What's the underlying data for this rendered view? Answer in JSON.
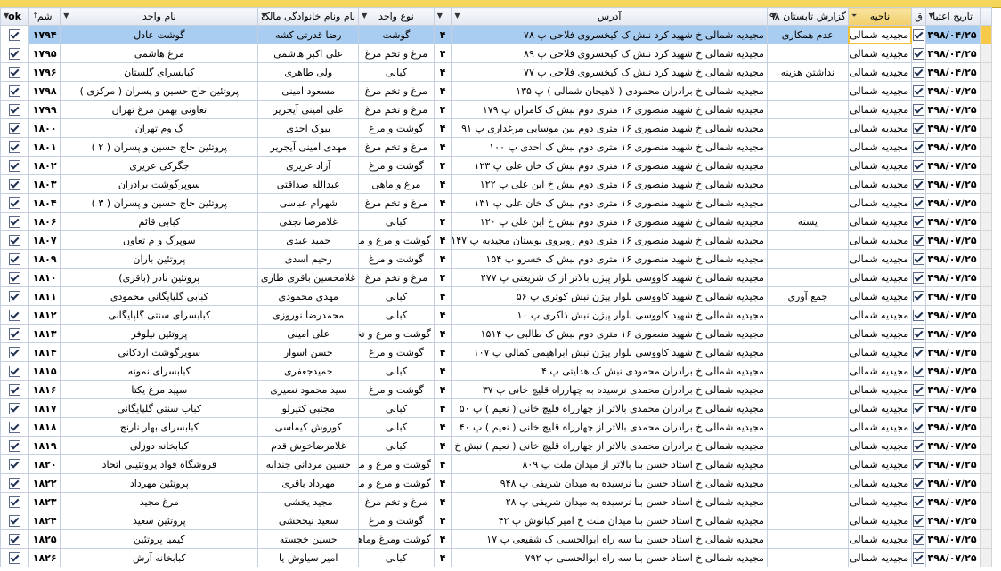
{
  "columns": [
    {
      "key": "validity_date",
      "label": "تاریخ اعتبا"
    },
    {
      "key": "qr",
      "label": "ق"
    },
    {
      "key": "region",
      "label": "ناحیه"
    },
    {
      "key": "report",
      "label": "گزارش تابستان ۹۸"
    },
    {
      "key": "address",
      "label": "آدرس"
    },
    {
      "key": "n4",
      "label": ""
    },
    {
      "key": "unit_type",
      "label": "نوع واحد"
    },
    {
      "key": "owner",
      "label": "نام ونام خانوادگی مالک"
    },
    {
      "key": "unit_name",
      "label": "نام واحد"
    },
    {
      "key": "number",
      "label": "شم"
    },
    {
      "key": "ok",
      "label": "ok"
    }
  ],
  "rows": [
    {
      "date": "۱۳۹۸/۰۴/۲۵",
      "region": "مجیدیه شمالی",
      "report": "عدم همکاری",
      "address": "مجیدیه شمالی خ شهید کرد نبش ک کیخسروی فلاحی پ ۷۸",
      "n4": "۴",
      "type": "گوشت",
      "owner": "رضا قدرتی کشه",
      "name": "گوشت عادل",
      "num": "۱۷۹۴",
      "selected": true
    },
    {
      "date": "۱۳۹۸/۰۴/۲۵",
      "region": "مجیدیه شمالی",
      "report": "",
      "address": "مجیدیه شمالی خ شهید کرد نبش ک کیخسروی فلاحی پ ۸۹",
      "n4": "۴",
      "type": "مرغ و تخم مرغ",
      "owner": "علی اکبر هاشمی",
      "name": "مرغ هاشمی",
      "num": "۱۷۹۵"
    },
    {
      "date": "۱۳۹۸/۰۴/۲۵",
      "region": "مجیدیه شمالی",
      "report": "نداشتن هزینه",
      "address": "مجیدیه شمالی خ شهید کرد نبش ک کیخسروی فلاحی پ ۷۷",
      "n4": "۴",
      "type": "کبابی",
      "owner": "ولی طاهری",
      "name": "کبابسرای گلستان",
      "num": "۱۷۹۶"
    },
    {
      "date": "۱۳۹۸/۰۷/۲۵",
      "region": "مجیدیه شمالی",
      "report": "",
      "address": "مجیدیه شمالی خ برادران محمودی ( لاهیجان شمالی ) پ ۱۳۵",
      "n4": "۴",
      "type": "مرغ و تخم مرغ",
      "owner": "مسعود امینی",
      "name": "پروتئین حاج حسین و پسران ( مرکزی )",
      "num": "۱۷۹۸"
    },
    {
      "date": "۱۳۹۸/۰۷/۲۵",
      "region": "مجیدیه شمالی",
      "report": "",
      "address": "مجیدیه شمالی خ شهید منصوری ۱۶ متری دوم نبش ک کامران پ ۱۷۹",
      "n4": "۴",
      "type": "مرغ و تخم مرغ",
      "owner": "علی امینی آیجریر",
      "name": "تعاونی بهمن مرغ تهران",
      "num": "۱۷۹۹"
    },
    {
      "date": "۱۳۹۸/۰۷/۲۵",
      "region": "مجیدیه شمالی",
      "report": "",
      "address": "مجیدیه شمالی خ شهید منصوری ۱۶ متری دوم بین موسایی مرغداری پ ۹۱",
      "n4": "۴",
      "type": "گوشت و مرغ",
      "owner": "بیوک احدی",
      "name": "گ وم تهران",
      "num": "۱۸۰۰"
    },
    {
      "date": "۱۳۹۸/۰۷/۲۵",
      "region": "مجیدیه شمالی",
      "report": "",
      "address": "مجیدیه شمالی خ شهید منصوری ۱۶ متری دوم نبش ک احدی پ ۱۰۰",
      "n4": "۴",
      "type": "مرغ و تخم مرغ",
      "owner": "مهدی امینی آیجریر",
      "name": "پروتئین حاج حسین و پسران ( ۲ )",
      "num": "۱۸۰۱"
    },
    {
      "date": "۱۳۹۸/۰۷/۲۵",
      "region": "مجیدیه شمالی",
      "report": "",
      "address": "مجیدیه شمالی خ شهید منصوری ۱۶ متری دوم نبش ک خان علی پ ۱۲۳",
      "n4": "۴",
      "type": "گوشت و مرغ",
      "owner": "آزاد عزیزی",
      "name": "جگرکی عزیزی",
      "num": "۱۸۰۲"
    },
    {
      "date": "۱۳۹۸/۰۷/۲۵",
      "region": "مجیدیه شمالی",
      "report": "",
      "address": "مجیدیه شمالی خ شهید منصوری ۱۶ متری دوم نبش خ ابن علی پ ۱۲۲",
      "n4": "۴",
      "type": "مرغ و ماهی",
      "owner": "عبدالله صداقتی",
      "name": "سوپرگوشت برادران",
      "num": "۱۸۰۳"
    },
    {
      "date": "۱۳۹۸/۰۷/۲۵",
      "region": "مجیدیه شمالی",
      "report": "",
      "address": "مجیدیه شمالی خ شهید منصوری ۱۶ متری دوم نبش ک خان علی پ ۱۳۱",
      "n4": "۴",
      "type": "مرغ و تخم مرغ",
      "owner": "شهرام عباسی",
      "name": "پروتئین حاج حسین و پسران ( ۳ )",
      "num": "۱۸۰۴"
    },
    {
      "date": "۱۳۹۸/۰۷/۲۵",
      "region": "مجیدیه شمالی",
      "report": "یسته",
      "address": "مجیدیه شمالی خ شهید منصوری ۱۶ متری دوم نبش خ ابن علی پ ۱۲۰",
      "n4": "۴",
      "type": "کبابی",
      "owner": "غلامرضا نجفی",
      "name": "کبابی قائم",
      "num": "۱۸۰۶"
    },
    {
      "date": "۱۳۹۸/۰۷/۲۵",
      "region": "مجیدیه شمالی",
      "report": "",
      "address": "مجیدیه شمالی خ شهید منصوری ۱۶ متری دوم روبروی بوستان مجیدیه پ ۱۴۷",
      "n4": "۴",
      "type": "گوشت و مرغ و ماهی",
      "owner": "حمید عبدی",
      "name": "سوپرگ و م تعاون",
      "num": "۱۸۰۷"
    },
    {
      "date": "۱۳۹۸/۰۷/۲۵",
      "region": "مجیدیه شمالی",
      "report": "",
      "address": "مجیدیه شمالی خ شهید منصوری ۱۶ متری دوم نبش ک خسرو پ ۱۵۴",
      "n4": "۴",
      "type": "گوشت و مرغ",
      "owner": "رحیم اسدی",
      "name": "پروتئین باران",
      "num": "۱۸۰۹"
    },
    {
      "date": "۱۳۹۸/۰۷/۲۵",
      "region": "مجیدیه شمالی",
      "report": "",
      "address": "مجیدیه شمالی خ شهید کاووسی بلوار پیژن بالاتر از ک شریعتی پ ۲۷۷",
      "n4": "۴",
      "type": "مرغ و تخم مرغ",
      "owner": "غلامحسین باقری طاری",
      "name": "پروتئین نادر (باقری)",
      "num": "۱۸۱۰"
    },
    {
      "date": "۱۳۹۸/۰۷/۲۵",
      "region": "مجیدیه شمالی",
      "report": "جمع آوری",
      "address": "مجیدیه شمالی خ شهید کاووسی بلوار پیژن نبش کوثری پ ۵۶",
      "n4": "۴",
      "type": "کبابی",
      "owner": "مهدی محمودی",
      "name": "کبابی گلپایگانی محمودی",
      "num": "۱۸۱۱"
    },
    {
      "date": "۱۳۹۸/۰۷/۲۵",
      "region": "مجیدیه شمالی",
      "report": "",
      "address": "مجیدیه شمالی خ شهید کاووسی بلوار پیژن نبش ذاکری پ ۱۰",
      "n4": "۴",
      "type": "کبابی",
      "owner": "محمدرضا نوروزی",
      "name": "کبابسرای سنتی گلپایگانی",
      "num": "۱۸۱۲"
    },
    {
      "date": "۱۳۹۸/۰۷/۲۵",
      "region": "مجیدیه شمالی",
      "report": "",
      "address": "مجیدیه شمالی خ شهید منصوری ۱۶ متری دوم نبش ک طالبی پ ۱۵۱۴",
      "n4": "۴",
      "type": "گوشت و مرغ و تخم مرغ",
      "owner": "علی امینی",
      "name": "پروتئین نیلوفر",
      "num": "۱۸۱۳"
    },
    {
      "date": "۱۳۹۸/۰۷/۲۵",
      "region": "مجیدیه شمالی",
      "report": "",
      "address": "مجیدیه شمالی خ شهید کاووسی بلوار پیژن نبش ابراهیمی کمالی پ ۱۰۷",
      "n4": "۴",
      "type": "گوشت و مرغ",
      "owner": "حسن اسوار",
      "name": "سوپرگوشت اردکانی",
      "num": "۱۸۱۴"
    },
    {
      "date": "۱۳۹۸/۰۷/۲۵",
      "region": "مجیدیه شمالی",
      "report": "",
      "address": "مجیدیه شمالی خ برادران محمودی نبش ک هدایتی پ ۴",
      "n4": "۴",
      "type": "کبابی",
      "owner": "حمیدجعفری",
      "name": "کبابسرای نمونه",
      "num": "۱۸۱۵"
    },
    {
      "date": "۱۳۹۸/۰۷/۲۵",
      "region": "مجیدیه شمالی",
      "report": "",
      "address": "مجیدیه شمالی خ برادران محمدی نرسیده به چهارراه قلیچ خانی پ ۳۷",
      "n4": "۴",
      "type": "گوشت و مرغ",
      "owner": "سید محمود نصیری",
      "name": "سپید مرغ یکتا",
      "num": "۱۸۱۶"
    },
    {
      "date": "۱۳۹۸/۰۷/۲۵",
      "region": "مجیدیه شمالی",
      "report": "",
      "address": "مجیدیه شمالی خ برادران محمدی بالاتر از چهارراه قلیچ خانی ( نعیم ) پ ۵۰",
      "n4": "۴",
      "type": "کبابی",
      "owner": "مجتبی کثیرلو",
      "name": "کباب سنتی گلپایگانی",
      "num": "۱۸۱۷"
    },
    {
      "date": "۱۳۹۸/۰۷/۲۵",
      "region": "مجیدیه شمالی",
      "report": "",
      "address": "مجیدیه شمالی خ برادران محمدی بالاتر از چهارراه قلیچ خانی ( نعیم ) پ ۴۰",
      "n4": "۴",
      "type": "کبابی",
      "owner": "کوروش کیماسی",
      "name": "کبابسرای بهار نارنج",
      "num": "۱۸۱۸"
    },
    {
      "date": "۱۳۹۸/۰۷/۲۵",
      "region": "مجیدیه شمالی",
      "report": "",
      "address": "مجیدیه شمالی خ برادران محمدی بالاتر از چهارراه قلیچ خانی ( نعیم ) نبش خ غفاری",
      "n4": "۴",
      "type": "کبابی",
      "owner": "غلامرضاخوش قدم",
      "name": "کبابخانه دوزلی",
      "num": "۱۸۱۹"
    },
    {
      "date": "۱۳۹۸/۰۷/۲۵",
      "region": "مجیدیه شمالی",
      "report": "",
      "address": "مجیدیه شمالی خ استاد حسن بنا بالاتر از میدان ملت پ ۸۰۹",
      "n4": "۴",
      "type": "گوشت و مرغ و ماهی",
      "owner": "حسین مردانی جندابه",
      "name": "فروشگاه فواد پروتئینی اتحاد",
      "num": "۱۸۲۰"
    },
    {
      "date": "۱۳۹۸/۰۷/۲۵",
      "region": "مجیدیه شمالی",
      "report": "",
      "address": "مجیدیه شمالی خ استاد حسن بنا نرسیده به میدان شریفی پ ۹۴۸",
      "n4": "۴",
      "type": "گوشت و مرغ و ماهی",
      "owner": "مهرداد باقری",
      "name": "پروتئین مهرداد",
      "num": "۱۸۲۲"
    },
    {
      "date": "۱۳۹۸/۰۷/۲۵",
      "region": "مجیدیه شمالی",
      "report": "",
      "address": "مجیدیه شمالی خ استاد حسن بنا نرسیده به میدان شریفی پ ۲۸",
      "n4": "۴",
      "type": "مرغ و تخم مرغ",
      "owner": "مجید یخشی",
      "name": "مرغ مجید",
      "num": "۱۸۲۳"
    },
    {
      "date": "۱۳۹۸/۰۷/۲۵",
      "region": "مجیدیه شمالی",
      "report": "",
      "address": "مجیدیه شمالی خ استاد حسن بنا میدان ملت خ امیر کیانوش پ ۴۲",
      "n4": "۴",
      "type": "گوشت و مرغ",
      "owner": "سعید نیجخشی",
      "name": "پروتئین سعید",
      "num": "۱۸۲۴"
    },
    {
      "date": "۱۳۹۸/۰۷/۲۵",
      "region": "مجیدیه شمالی",
      "report": "",
      "address": "مجیدیه شمالی خ استاد حسن بنا سه راه ابوالحسنی ک شفیعی پ ۱۷",
      "n4": "۴",
      "type": "گوشت ومرغ وماهی",
      "owner": "حسین خجسته",
      "name": "کیمیا پروتئین",
      "num": "۱۸۲۵"
    },
    {
      "date": "۱۳۹۸/۰۷/۲۵",
      "region": "مجیدیه شمالی",
      "report": "",
      "address": "مجیدیه شمالی خ استاد حسن بنا سه راه ابوالحسنی پ ۷۹۲",
      "n4": "۴",
      "type": "کبابی",
      "owner": "امیر سیاوش یا",
      "name": "کبابخانه آرش",
      "num": "۱۸۲۶"
    }
  ]
}
